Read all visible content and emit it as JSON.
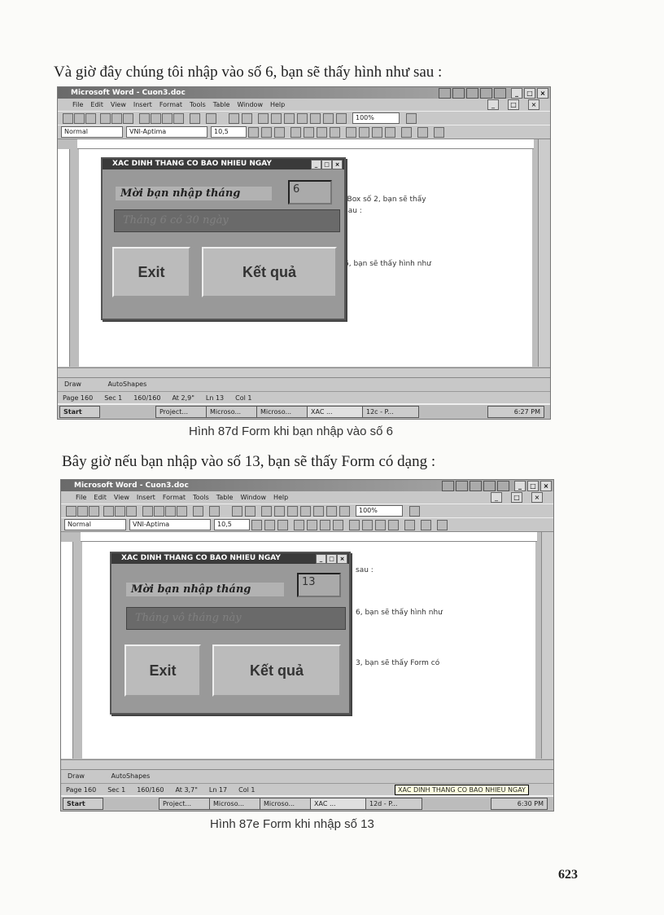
{
  "intro_text": "Và giờ đây chúng tôi nhập vào số 6, bạn sẽ thấy hình như sau :",
  "middle_text": "Bây giờ nếu bạn nhập vào số 13, bạn sẽ thấy Form có dạng :",
  "page_number": "623",
  "app": {
    "title1": "Microsoft Word - Cuon3.doc",
    "title2": "Microsoft Word - Cuon3.doc",
    "menus": [
      "File",
      "Edit",
      "View",
      "Insert",
      "Format",
      "Tools",
      "Table",
      "Window",
      "Help"
    ],
    "style": "Normal",
    "font": "VNI-Aptima",
    "size": "10,5",
    "zoom": "100%",
    "draw_label": "Draw",
    "autoshapes_label": "AutoShapes"
  },
  "figure1": {
    "caption": "Hình 87d  Form khi bạn nhập vào số 6",
    "form_title": "XAC DINH THANG CO BAO NHIEU NGAY",
    "prompt_label": "Mời bạn nhập tháng",
    "input_value": "6",
    "result_text": "Tháng 6 có 30 ngày",
    "exit_label": "Exit",
    "result_button_label": "Kết quả",
    "doc_lines": [
      "tBox số 2, bạn sẽ thấy",
      "sau :",
      "6, bạn sẽ thấy hình như"
    ],
    "status": [
      "Page 160",
      "Sec 1",
      "160/160",
      "At 2,9\"",
      "Ln 13",
      "Col 1"
    ],
    "taskbar": [
      "Start",
      "Project...",
      "Microso...",
      "Microso...",
      "XAC ...",
      "12c - P..."
    ],
    "clock": "6:27 PM",
    "tooltip": ""
  },
  "figure2": {
    "caption": "Hình  87e  Form khi nhập số 13",
    "form_title": "XAC DINH THANG CO BAO NHIEU NGAY",
    "prompt_label": "Mời bạn nhập tháng",
    "input_value": "13",
    "result_text": "Tháng vô tháng này",
    "exit_label": "Exit",
    "result_button_label": "Kết quả",
    "doc_lines": [
      "sau :",
      "6, bạn sẽ thấy hình như",
      "3, bạn sẽ thấy Form có"
    ],
    "status": [
      "Page 160",
      "Sec 1",
      "160/160",
      "At 3,7\"",
      "Ln 17",
      "Col 1"
    ],
    "taskbar": [
      "Start",
      "Project...",
      "Microso...",
      "Microso...",
      "XAC ...",
      "12d - P..."
    ],
    "clock": "6:30 PM",
    "tooltip": "XAC DINH THANG CO BAO NHIEU NGAY"
  }
}
